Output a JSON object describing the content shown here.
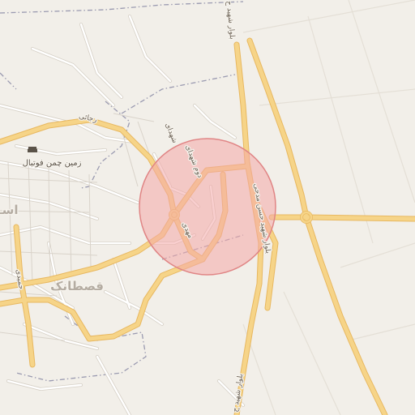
{
  "map": {
    "highlight_circle": {
      "fill": "#f4a7a7",
      "stroke": "#e08585"
    },
    "colors": {
      "land": "#f2efe9",
      "road_major": "#f6d488",
      "road_major_casing": "#e8b860",
      "road_minor": "#ffffff",
      "road_minor_casing": "#d6d0c6",
      "boundary": "#9a9ab0"
    },
    "labels": {
      "poi_football": "زمین چمن فوتبال",
      "town": "قصطانک",
      "town_edge": "اسـ",
      "road_rajai": "رجائی",
      "road_duvom": "دوم شهدای",
      "road_shohada": "شهدای",
      "road_mahdi": "مهدی",
      "blvd_north": "بلوار شهید ح",
      "blvd_main": "بلوار شهید حسن مدحی",
      "blvd_south": "بلوار شهید ح",
      "road_west": "حمیدی"
    },
    "icons": {
      "poi_football": "stadium-icon"
    }
  }
}
